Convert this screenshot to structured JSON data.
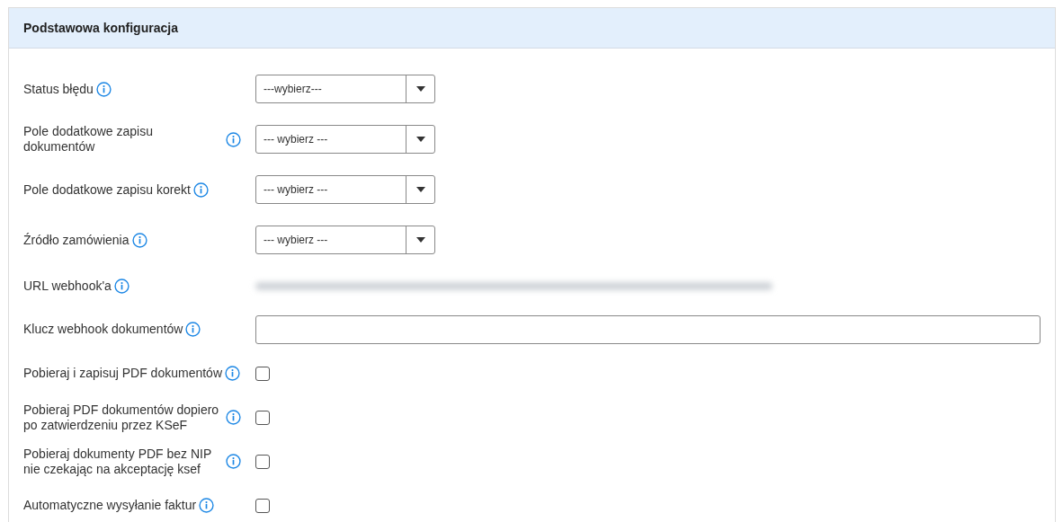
{
  "panel": {
    "title": "Podstawowa konfiguracja"
  },
  "fields": [
    {
      "kind": "select",
      "label": "Status błędu",
      "value": "---wybierz---"
    },
    {
      "kind": "select",
      "label": "Pole dodatkowe zapisu dokumentów",
      "value": "--- wybierz ---"
    },
    {
      "kind": "select",
      "label": "Pole dodatkowe zapisu korekt",
      "value": "--- wybierz ---"
    },
    {
      "kind": "select",
      "label": "Źródło zamówienia",
      "value": "--- wybierz ---"
    },
    {
      "kind": "redacted",
      "label": "URL webhook'a"
    },
    {
      "kind": "input",
      "label": "Klucz webhook dokumentów"
    },
    {
      "kind": "checkbox",
      "label": "Pobieraj i zapisuj PDF dokumentów",
      "checked": false
    },
    {
      "kind": "checkbox",
      "label": "Pobieraj PDF dokumentów dopiero po zatwierdzeniu przez KSeF",
      "checked": false
    },
    {
      "kind": "checkbox",
      "label": "Pobieraj dokumenty PDF bez NIP nie czekając na akceptację ksef",
      "checked": false
    },
    {
      "kind": "checkbox",
      "label": "Automatyczne wysyłanie faktur",
      "checked": false
    }
  ]
}
